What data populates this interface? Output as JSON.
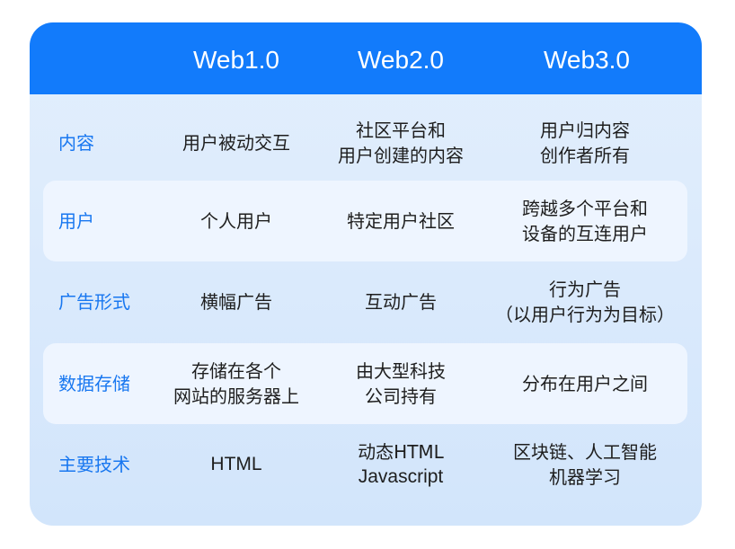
{
  "header": {
    "columns": [
      "Web1.0",
      "Web2.0",
      "Web3.0"
    ]
  },
  "colors": {
    "header_bg": "#127bfb",
    "label_text": "#1877f0",
    "body_bg": "#dbeafc",
    "alt_row_bg": "#eef5ff"
  },
  "rows": [
    {
      "label": "内容",
      "web1": [
        "用户被动交互"
      ],
      "web2": [
        "社区平台和",
        "用户创建的内容"
      ],
      "web3": [
        "用户归内容",
        "创作者所有"
      ]
    },
    {
      "label": "用户",
      "web1": [
        "个人用户"
      ],
      "web2": [
        "特定用户社区"
      ],
      "web3": [
        "跨越多个平台和",
        "设备的互连用户"
      ]
    },
    {
      "label": "广告形式",
      "web1": [
        "横幅广告"
      ],
      "web2": [
        "互动广告"
      ],
      "web3": [
        "行为广告",
        "（以用户行为为目标）"
      ]
    },
    {
      "label": "数据存储",
      "web1": [
        "存储在各个",
        "网站的服务器上"
      ],
      "web2": [
        "由大型科技",
        "公司持有"
      ],
      "web3": [
        "分布在用户之间"
      ]
    },
    {
      "label": "主要技术",
      "web1": [
        "HTML"
      ],
      "web2": [
        "动态HTML",
        "Javascript"
      ],
      "web3": [
        "区块链、人工智能",
        "机器学习"
      ]
    }
  ]
}
